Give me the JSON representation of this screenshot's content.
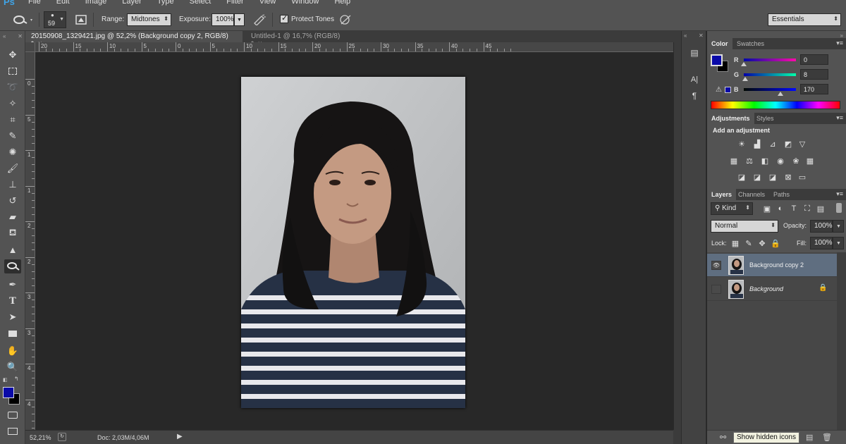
{
  "app": {
    "logo": "Ps"
  },
  "menu": [
    "File",
    "Edit",
    "Image",
    "Layer",
    "Type",
    "Select",
    "Filter",
    "View",
    "Window",
    "Help"
  ],
  "options": {
    "brush_size": "59",
    "range_label": "Range:",
    "range_value": "Midtones",
    "exposure_label": "Exposure:",
    "exposure_value": "100%",
    "protect_tones_label": "Protect Tones",
    "protect_tones_checked": true,
    "workspace": "Essentials"
  },
  "tabs": [
    {
      "label": "20150908_1329421.jpg @ 52,2% (Background copy 2, RGB/8) *",
      "active": true
    },
    {
      "label": "Untitled-1 @ 16,7% (RGB/8) *",
      "active": false
    }
  ],
  "ruler": {
    "h_labels": [
      "20",
      "15",
      "10",
      "5",
      "0",
      "5",
      "10",
      "15",
      "20",
      "25",
      "30",
      "35",
      "40",
      "45"
    ],
    "v_labels": [
      "0",
      "5",
      "1",
      "1",
      "2",
      "2",
      "3",
      "3",
      "4",
      "4",
      "5"
    ]
  },
  "status": {
    "zoom": "52,21%",
    "doc": "Doc: 2,03M/4,06M"
  },
  "color_panel": {
    "tabs": [
      "Color",
      "Swatches"
    ],
    "foreground": "#0a0aa8",
    "background": "#000000",
    "r_label": "R",
    "r_value": "0",
    "g_label": "G",
    "g_value": "8",
    "b_label": "B",
    "b_value": "170"
  },
  "adjustments_panel": {
    "tabs": [
      "Adjustments",
      "Styles"
    ],
    "heading": "Add an adjustment"
  },
  "layers_panel": {
    "tabs": [
      "Layers",
      "Channels",
      "Paths"
    ],
    "filter_kind": "Kind",
    "blend_mode": "Normal",
    "opacity_label": "Opacity:",
    "opacity_value": "100%",
    "lock_label": "Lock:",
    "fill_label": "Fill:",
    "fill_value": "100%",
    "layers": [
      {
        "name": "Background copy 2",
        "selected": true,
        "visible": true
      },
      {
        "name": "Background",
        "selected": false,
        "visible": false,
        "locked": true
      }
    ]
  },
  "tooltip": "Show hidden icons"
}
